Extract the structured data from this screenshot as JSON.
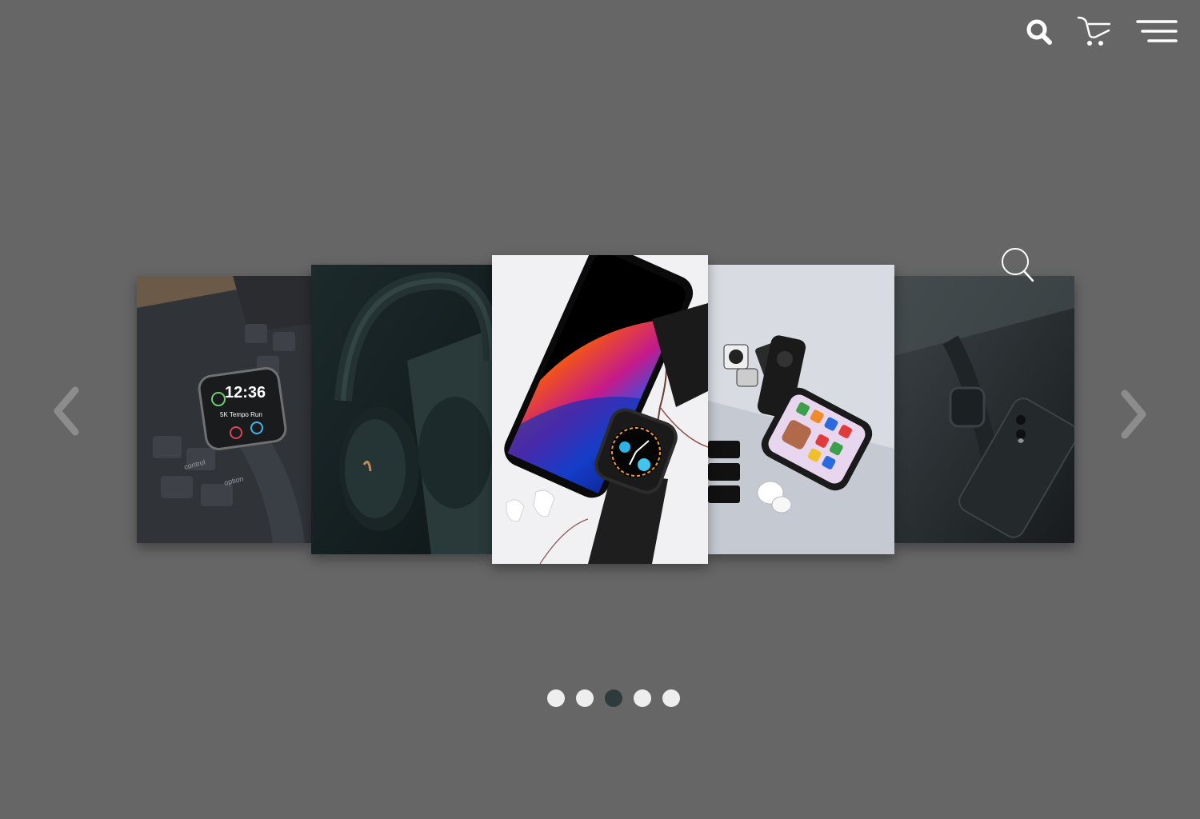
{
  "header": {
    "icons": [
      "search-icon",
      "cart-icon",
      "menu-icon"
    ]
  },
  "carousel": {
    "slides": [
      {
        "subject": "smartwatch-on-keyboard",
        "watch_time": "12:36",
        "watch_title": "5K Tempo Run",
        "key_labels": [
          "control",
          "option"
        ]
      },
      {
        "subject": "headphones"
      },
      {
        "subject": "phone-and-watch-on-marble"
      },
      {
        "subject": "phone-remote-earbuds-on-laptop"
      },
      {
        "subject": "phone-and-watch-dark"
      }
    ],
    "active_index": 2,
    "dot_count": 5,
    "zoom_icon": "zoom-icon",
    "prev_icon": "chevron-left-icon",
    "next_icon": "chevron-right-icon"
  },
  "colors": {
    "background": "#666666",
    "dot_inactive": "#eeeeee",
    "dot_active": "#2f3a3c"
  }
}
